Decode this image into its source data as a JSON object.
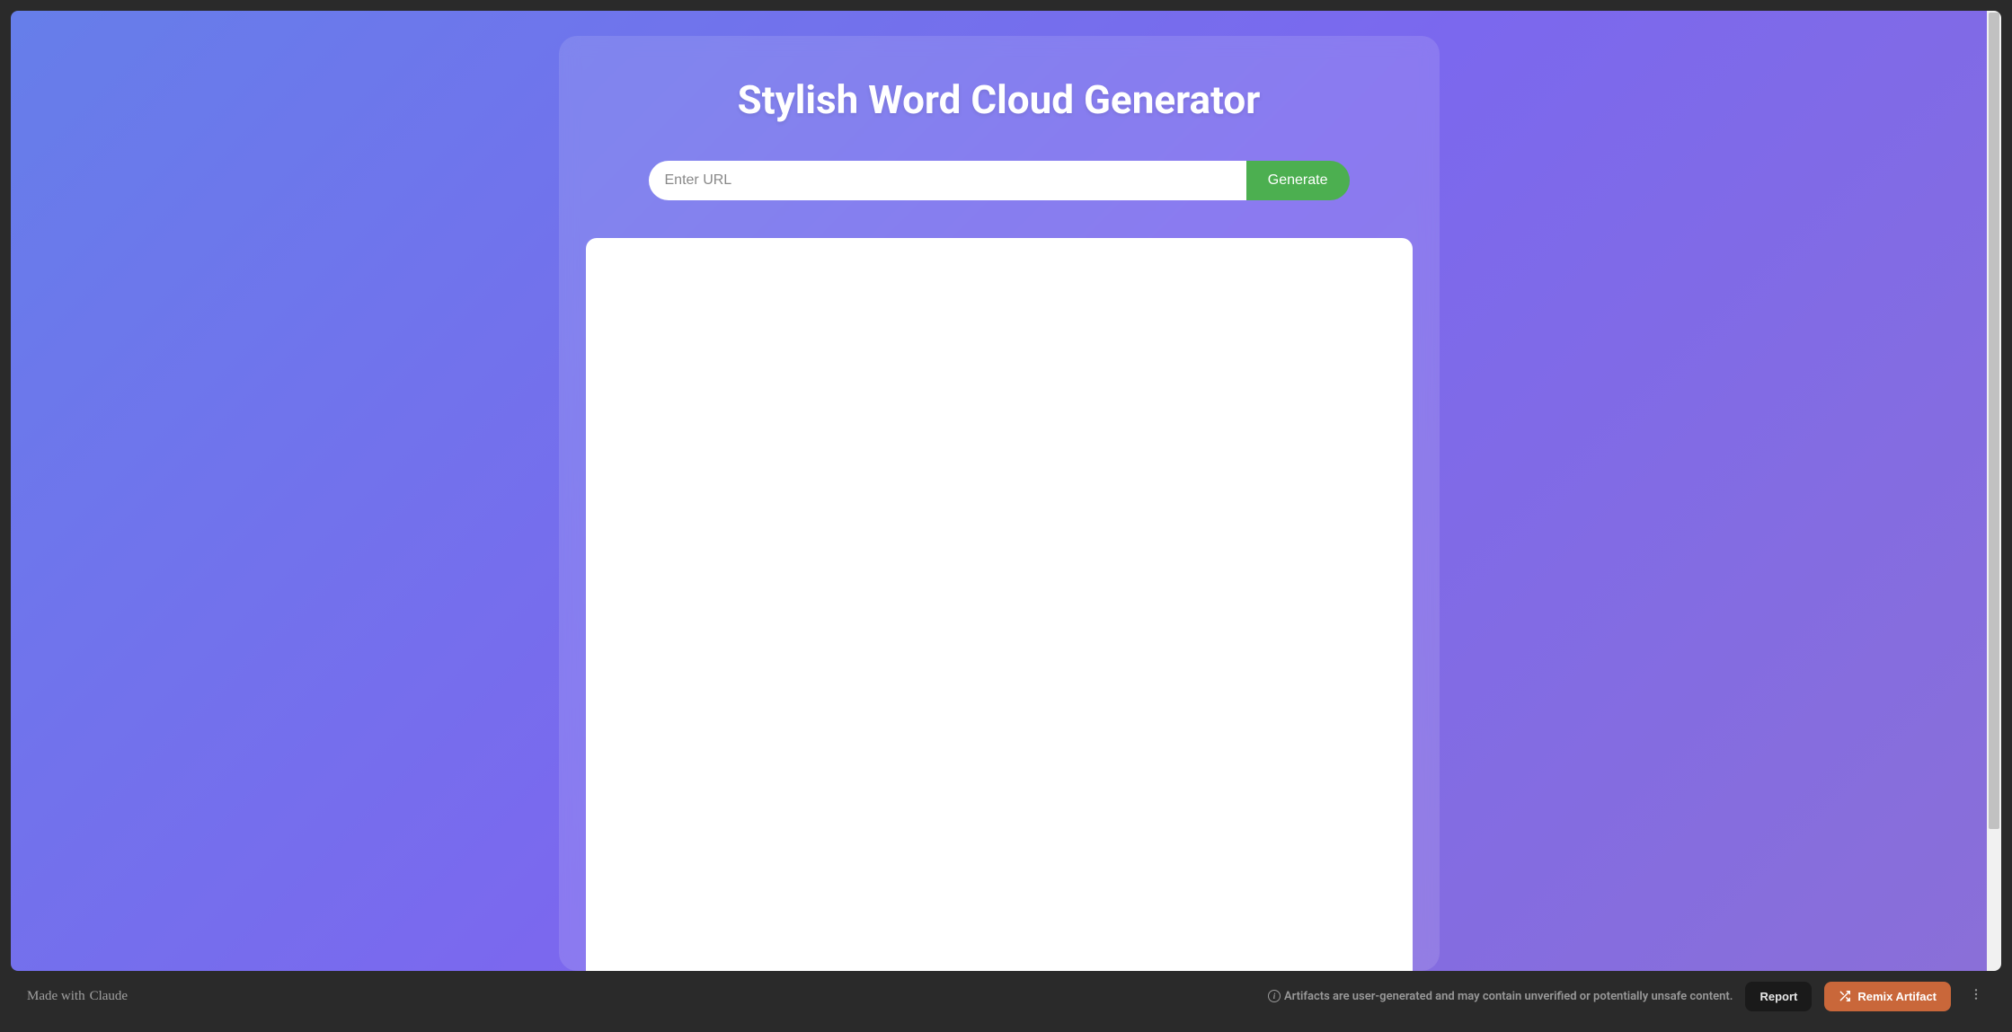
{
  "app": {
    "title": "Stylish Word Cloud Generator",
    "url_placeholder": "Enter URL",
    "url_value": "",
    "generate_label": "Generate"
  },
  "footer": {
    "made_with": "Made with",
    "brand": "Claude",
    "disclaimer": "Artifacts are user-generated and may contain unverified or potentially unsafe content.",
    "report_label": "Report",
    "remix_label": "Remix Artifact"
  }
}
